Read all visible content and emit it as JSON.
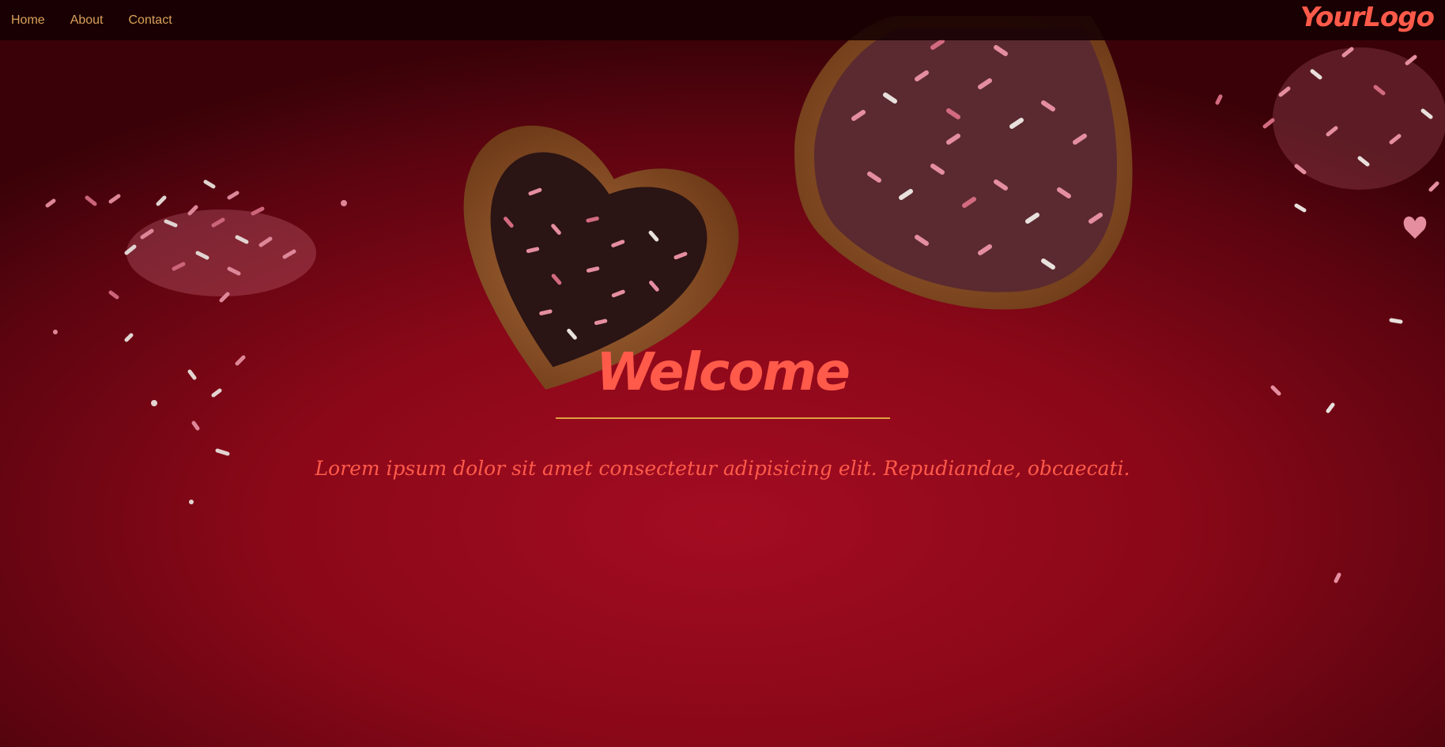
{
  "nav": {
    "links": [
      {
        "label": "Home"
      },
      {
        "label": "About"
      },
      {
        "label": "Contact"
      }
    ],
    "logo": "YourLogo"
  },
  "hero": {
    "title": "Welcome",
    "subtitle": "Lorem ipsum dolor sit amet consectetur adipisicing elit. Repudiandae, obcaecati."
  },
  "colors": {
    "background": "#8a0818",
    "accent": "#ff5a4a",
    "nav_text": "#d9a15a",
    "divider": "#e0a13e"
  }
}
